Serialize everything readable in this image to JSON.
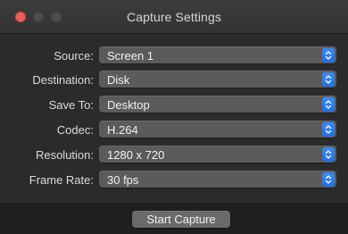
{
  "window": {
    "title": "Capture Settings"
  },
  "form": {
    "fields": [
      {
        "label": "Source:",
        "value": "Screen 1"
      },
      {
        "label": "Destination:",
        "value": "Disk"
      },
      {
        "label": "Save To:",
        "value": "Desktop"
      },
      {
        "label": "Codec:",
        "value": "H.264"
      },
      {
        "label": "Resolution:",
        "value": "1280 x 720"
      },
      {
        "label": "Frame Rate:",
        "value": "30 fps"
      }
    ]
  },
  "footer": {
    "start_button_label": "Start Capture"
  },
  "colors": {
    "window_background": "#2b2b2b",
    "popup_background": "#5b5b5b",
    "accent_blue": "#2a7df0",
    "close_button": "#ec5f59"
  },
  "icons": {
    "close": "close-icon",
    "minimize": "minimize-icon",
    "zoom": "zoom-icon",
    "popup_arrows": "up-down-chevron-icon"
  }
}
